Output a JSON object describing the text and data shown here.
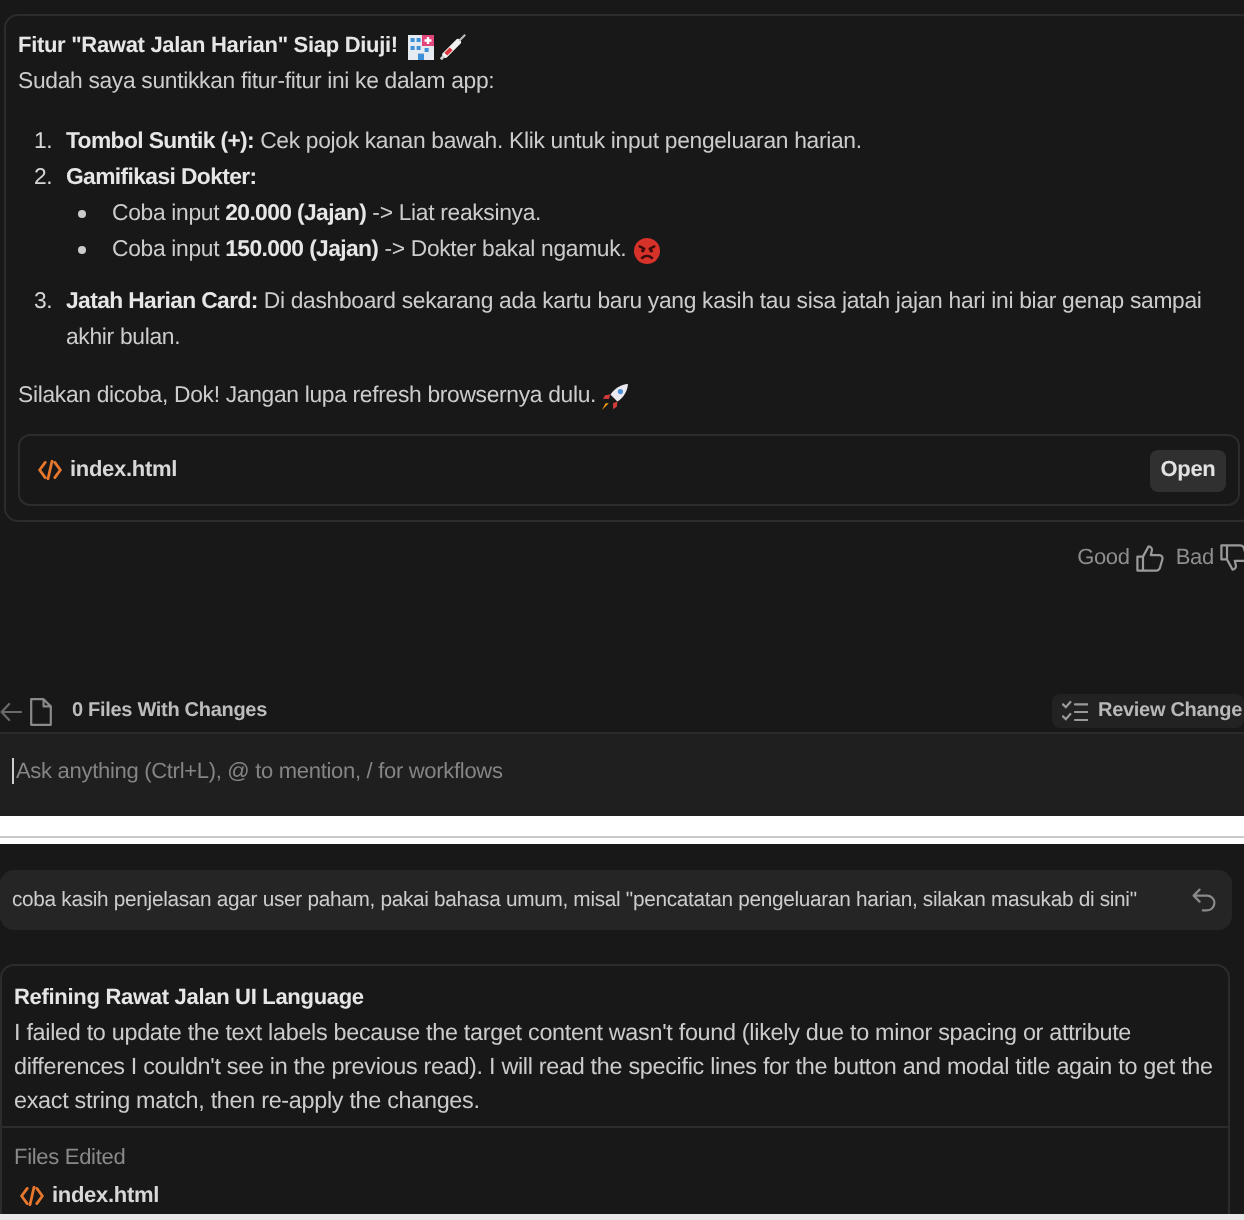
{
  "assistant_message": {
    "title": "Fitur \"Rawat Jalan Harian\" Siap Diuji!",
    "intro": "Sudah saya suntikkan fitur-fitur ini ke dalam app:",
    "steps": [
      {
        "number": "1.",
        "label": "Tombol Suntik (+):",
        "text": "Cek pojok kanan bawah. Klik untuk input pengeluaran harian."
      },
      {
        "number": "2.",
        "label": "Gamifikasi Dokter:",
        "children": [
          {
            "kind": "plain",
            "text": "Coba input **20.000 (Jajan)** -> Liat reaksinya."
          },
          {
            "kind": "reaction",
            "text": "Coba input **150.000 (Jajan)** -> Dokter bakal ngamuk."
          }
        ]
      },
      {
        "number": "3.",
        "label": "Jatah Harian Card:",
        "text": "Di dashboard sekarang ada kartu baru yang kasih tau sisa jatah jajan hari ini biar genap sampai akhir bulan."
      }
    ],
    "closing": "Silakan dicoba, Dok! Jangan lupa refresh browsernya dulu.",
    "file": {
      "name": "index.html",
      "button": "Open"
    }
  },
  "feedback": [
    {
      "kind": "good",
      "label": "Good"
    },
    {
      "kind": "bad",
      "label": "Bad"
    }
  ],
  "changes_bar": {
    "label": "0 Files With Changes",
    "button": "Review Change"
  },
  "chat_input": {
    "placeholder": "Ask anything (Ctrl+L), @ to mention, / for workflows"
  },
  "user_message": {
    "text": "coba kasih penjelasan agar user paham, pakai bahasa umum, misal \"pencatatan pengeluaran harian, silakan masukab di sini\""
  },
  "step_card": {
    "title": "Refining Rawat Jalan UI Language",
    "text": "I failed to update the text labels because the target content wasn't found (likely due to minor spacing or attribute differences I couldn't see in the previous read). I will read the specific lines for the button and modal title again to get the exact string match, then re-apply the changes.",
    "files_label": "Files Edited",
    "files": [
      "index.html"
    ]
  }
}
